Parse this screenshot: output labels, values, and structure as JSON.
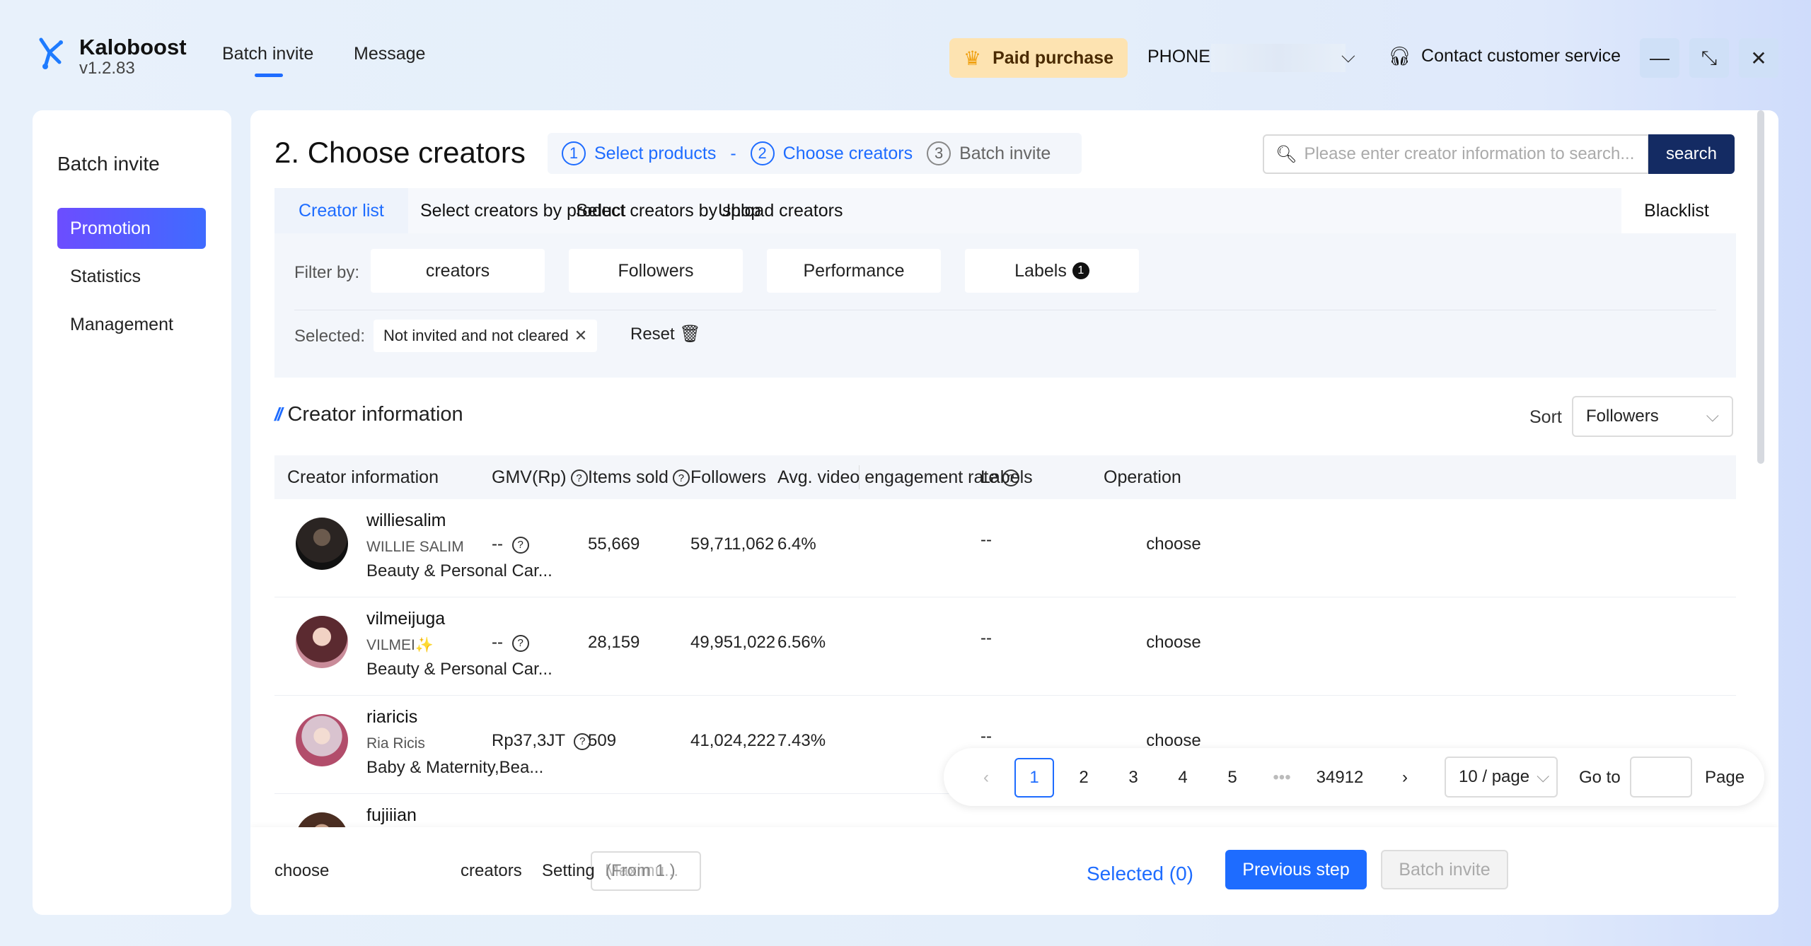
{
  "app": {
    "name": "Kaloboost",
    "version": "v1.2.83",
    "nav": [
      "Batch invite",
      "Message"
    ],
    "paid_label": "Paid purchase",
    "phone_label": "PHONE:",
    "contact_label": "Contact customer service"
  },
  "sidebar": {
    "title": "Batch invite",
    "items": [
      {
        "label": "Promotion",
        "active": true
      },
      {
        "label": "Statistics",
        "active": false
      },
      {
        "label": "Management",
        "active": false
      }
    ]
  },
  "main": {
    "title": "2. Choose creators",
    "steps": [
      {
        "num": "1",
        "label": "Select products"
      },
      {
        "num": "2",
        "label": "Choose creators"
      },
      {
        "num": "3",
        "label": "Batch invite"
      }
    ],
    "search": {
      "placeholder": "Please enter creator information to search...",
      "button": "search"
    },
    "tabs": [
      "Creator list",
      "Select creators by product",
      "Select creators by shop",
      "Upload creators"
    ],
    "blacklist": "Blacklist",
    "filter": {
      "label": "Filter by:",
      "buttons": [
        "creators",
        "Followers",
        "Performance",
        "Labels"
      ],
      "labels_badge": "1",
      "selected_label": "Selected:",
      "selected_chip": "Not invited and not cleared",
      "reset": "Reset"
    },
    "section_title": "Creator information",
    "sort": {
      "label": "Sort",
      "value": "Followers"
    },
    "table": {
      "headers": [
        "Creator information",
        "GMV(Rp)",
        "Items sold",
        "Followers",
        "Avg. video engagement rate",
        "Labels",
        "Operation"
      ],
      "rows": [
        {
          "username": "williesalim",
          "display": "WILLIE SALIM",
          "category": "Beauty & Personal Car...",
          "gmv": "--",
          "items": "55,669",
          "followers": "59,711,062",
          "engagement": "6.4%",
          "labels": "--",
          "op": "choose"
        },
        {
          "username": "vilmeijuga",
          "display": "VILMEI",
          "category": "Beauty & Personal Car...",
          "gmv": "--",
          "items": "28,159",
          "followers": "49,951,022",
          "engagement": "6.56%",
          "labels": "--",
          "op": "choose"
        },
        {
          "username": "riaricis",
          "display": "Ria Ricis",
          "category": "Baby & Maternity,Bea...",
          "gmv": "Rp37,3JT",
          "items": "509",
          "followers": "41,024,222",
          "engagement": "7.43%",
          "labels": "--",
          "op": "choose"
        },
        {
          "username": "fujiiian",
          "display": "",
          "category": "",
          "gmv": "",
          "items": "",
          "followers": "",
          "engagement": "",
          "labels": "",
          "op": ""
        }
      ]
    },
    "pagination": {
      "pages": [
        "1",
        "2",
        "3",
        "4",
        "5"
      ],
      "ellipsis": "•••",
      "last": "34912",
      "page_size": "10 / page",
      "goto": "Go to",
      "page": "Page",
      "current": 1
    },
    "footer": {
      "choose": "choose",
      "max_placeholder": "Maximu...",
      "creators": "creators",
      "setting": "Setting",
      "from": "(From 1 )",
      "selected": "Selected",
      "selected_count": "(0)",
      "prev": "Previous step",
      "batch": "Batch invite"
    }
  },
  "colors": {
    "accent": "#1e6cff",
    "navy": "#142b63",
    "paid_bg": "#fde3b1"
  }
}
